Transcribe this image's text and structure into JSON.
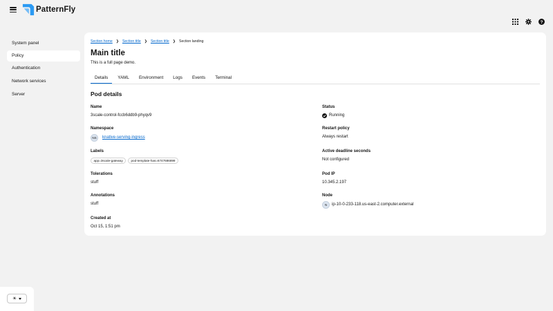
{
  "brand": {
    "name": "PatternFly"
  },
  "sidebar": {
    "items": [
      {
        "label": "System panel"
      },
      {
        "label": "Policy"
      },
      {
        "label": "Authentication"
      },
      {
        "label": "Network services"
      },
      {
        "label": "Server"
      }
    ],
    "active_index": 1
  },
  "toolbar": {
    "icons": [
      "apps-grid-icon",
      "settings-gear-icon",
      "help-icon"
    ]
  },
  "breadcrumb": {
    "items": [
      "Section home",
      "Section title",
      "Section title"
    ],
    "current": "Section landing"
  },
  "page": {
    "title": "Main title",
    "description": "This is a full page demo."
  },
  "tabs": {
    "items": [
      "Details",
      "YAML",
      "Environment",
      "Logs",
      "Events",
      "Terminal"
    ],
    "active_index": 0
  },
  "details": {
    "title": "Pod details",
    "name": {
      "label": "Name",
      "value": "3scale-control-fccb6ddb9-phyqv9"
    },
    "namespace": {
      "label": "Namespace",
      "avatar": "NS",
      "value": "knative-serving-ingress"
    },
    "labels": {
      "label": "Labels",
      "chips": [
        "app=3scale-gateway",
        "pod-template-has=6747686899"
      ]
    },
    "tolerations": {
      "label": "Tolerations",
      "value": "stuff"
    },
    "annotations": {
      "label": "Annotations",
      "value": "stuff"
    },
    "created": {
      "label": "Created at",
      "value": "Oct 15, 1:51 pm"
    },
    "status": {
      "label": "Status",
      "value": "Running"
    },
    "restart": {
      "label": "Restart policy",
      "value": "Always restart"
    },
    "deadline": {
      "label": "Active deadline seconds",
      "value": "Not configured"
    },
    "pod_ip": {
      "label": "Pod IP",
      "value": "10.345.2.197"
    },
    "node": {
      "label": "Node",
      "avatar": "N",
      "value": "ip-10-0-233-118.us-east-2.computer.external"
    }
  },
  "colors": {
    "link": "#0066cc",
    "background": "#f2f2f2",
    "card": "#ffffff"
  }
}
